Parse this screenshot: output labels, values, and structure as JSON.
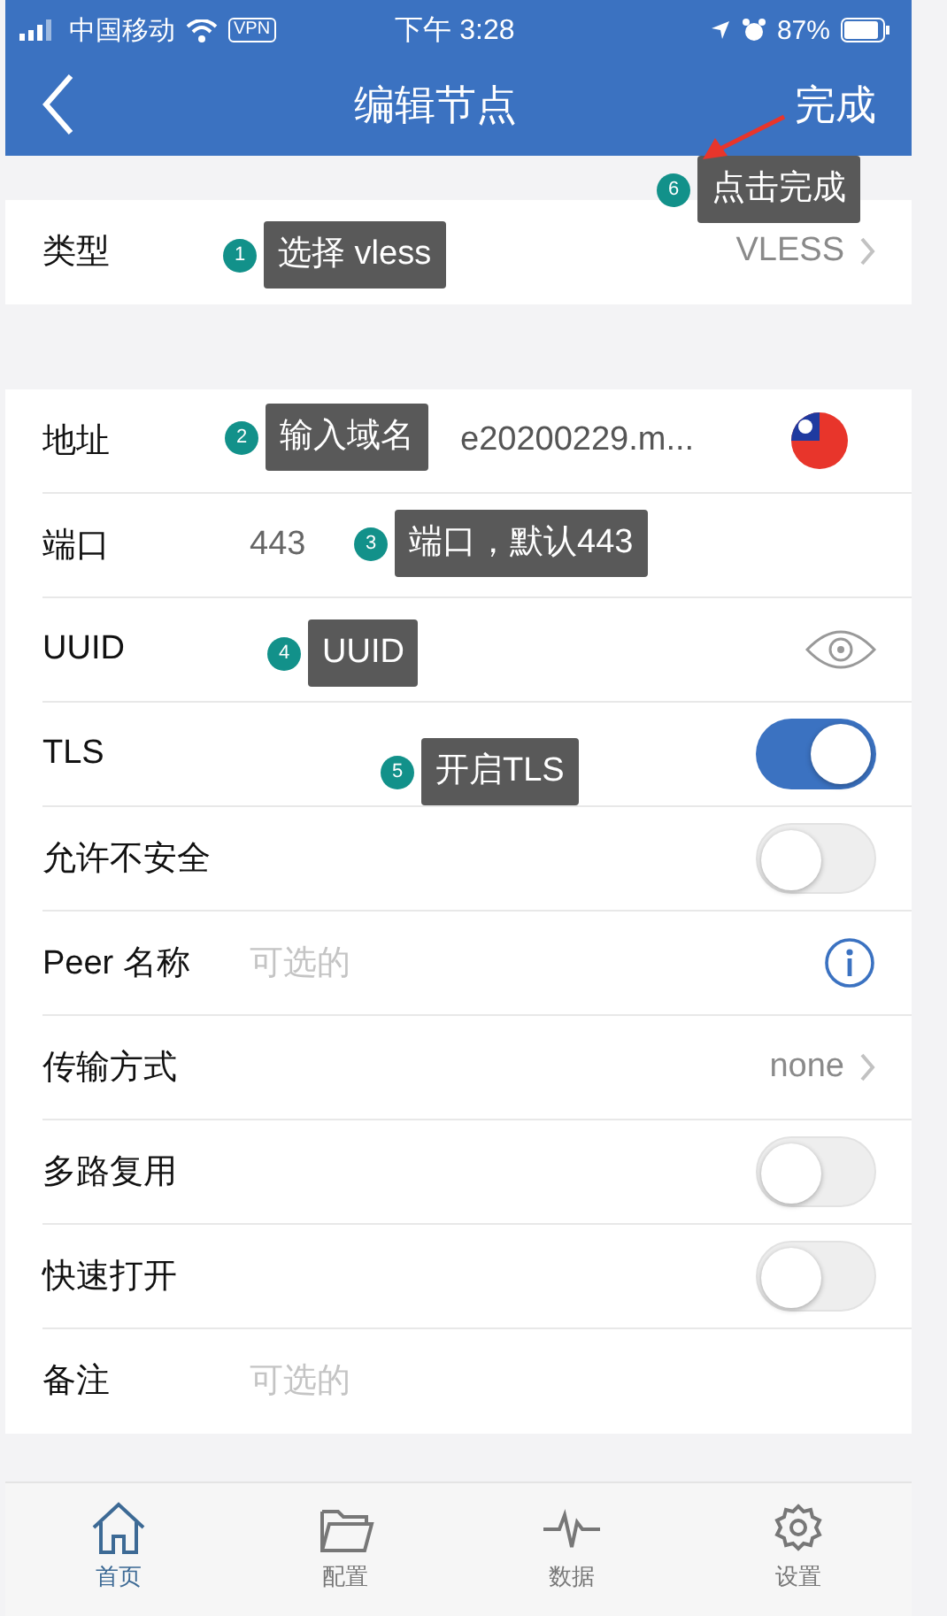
{
  "status_bar": {
    "carrier": "中国移动",
    "vpn": "VPN",
    "time": "下午 3:28",
    "battery": "87%"
  },
  "nav_bar": {
    "title": "编辑节点",
    "done": "完成"
  },
  "sections": [
    {
      "rows": [
        {
          "kind": "select",
          "label": "类型",
          "value": "VLESS"
        }
      ]
    },
    {
      "rows": [
        {
          "kind": "flag",
          "label": "地址",
          "value": "e20200229.m..."
        },
        {
          "kind": "text",
          "label": "端口",
          "value": "443"
        },
        {
          "kind": "secret",
          "label": "UUID"
        },
        {
          "kind": "toggle",
          "label": "TLS",
          "on": true
        },
        {
          "kind": "toggle",
          "label": "允许不安全",
          "on": false
        },
        {
          "kind": "input-info",
          "label": "Peer 名称",
          "placeholder": "可选的"
        },
        {
          "kind": "select",
          "label": "传输方式",
          "value": "none"
        },
        {
          "kind": "toggle",
          "label": "多路复用",
          "on": false
        },
        {
          "kind": "toggle",
          "label": "快速打开",
          "on": false
        },
        {
          "kind": "input",
          "label": "备注",
          "placeholder": "可选的"
        }
      ]
    }
  ],
  "annotations": [
    {
      "number": "6",
      "text": "点击完成",
      "arrow": true
    },
    {
      "number": "1",
      "text": "选择 vless",
      "arrow": false
    },
    {
      "number": "2",
      "text": "输入域名",
      "arrow": false
    },
    {
      "number": "3",
      "text": "端口，默认443",
      "arrow": false
    },
    {
      "number": "4",
      "text": "UUID",
      "arrow": false
    },
    {
      "number": "5",
      "text": "开启TLS",
      "arrow": false
    }
  ],
  "tab_bar": [
    {
      "label": "首页",
      "selected": true
    },
    {
      "label": "配置",
      "selected": false
    },
    {
      "label": "数据",
      "selected": false
    },
    {
      "label": "设置",
      "selected": false
    }
  ]
}
